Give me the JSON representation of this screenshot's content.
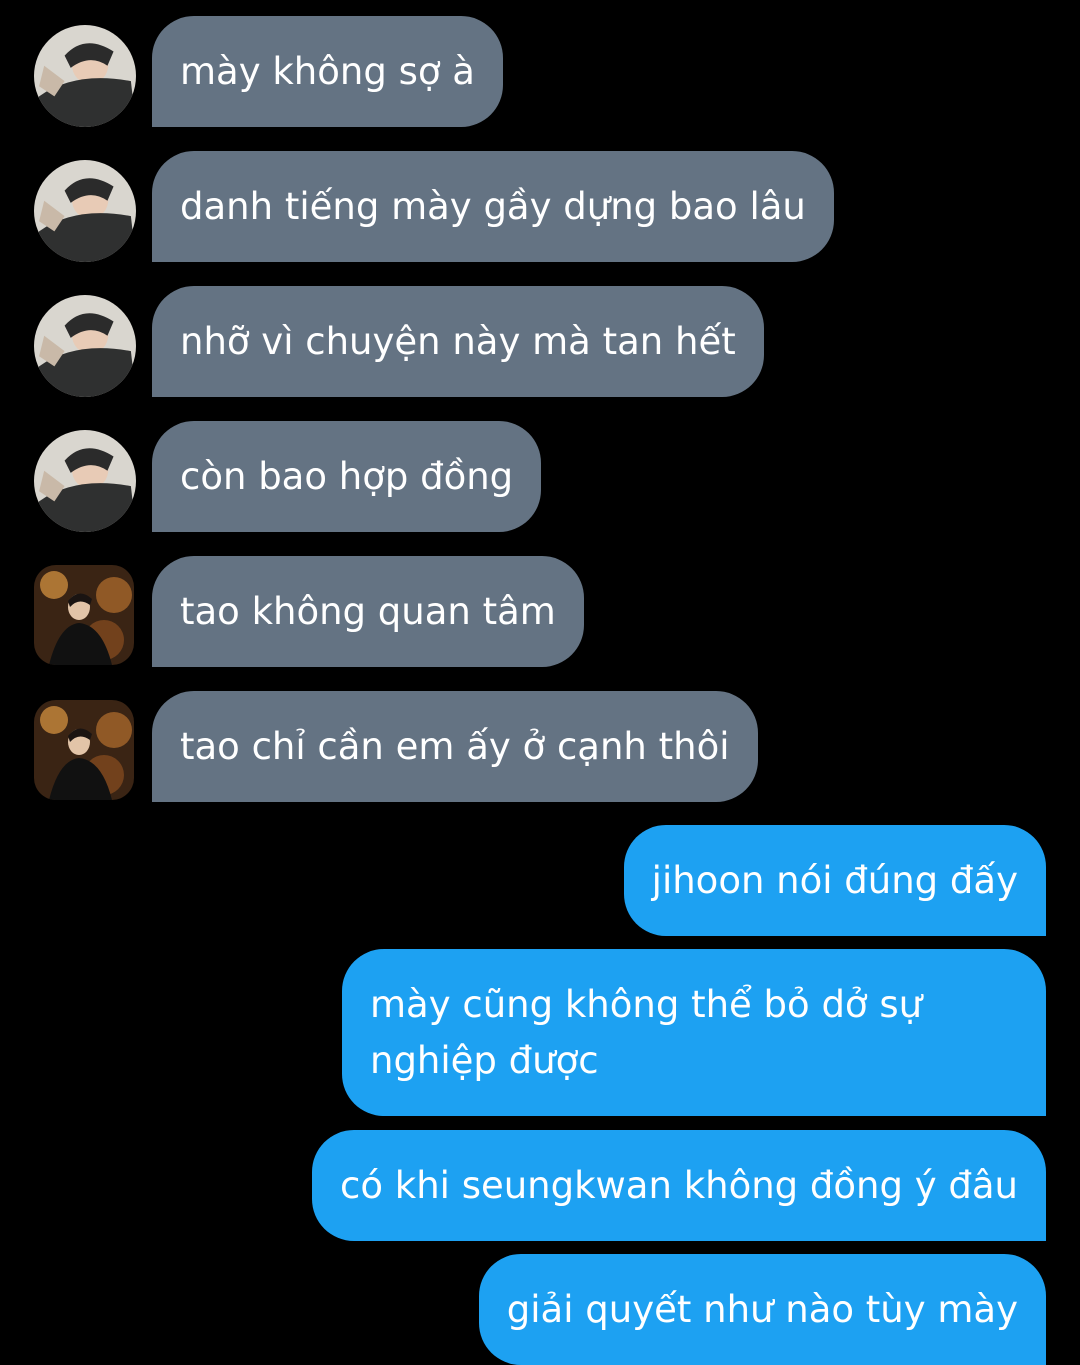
{
  "conversation": {
    "messages": [
      {
        "side": "in",
        "avatar": "avatar-a",
        "text": "mày không sợ à"
      },
      {
        "side": "in",
        "avatar": "avatar-a",
        "text": "danh tiếng mày gầy dựng bao lâu"
      },
      {
        "side": "in",
        "avatar": "avatar-a",
        "text": "nhỡ vì chuyện này mà tan hết"
      },
      {
        "side": "in",
        "avatar": "avatar-a",
        "text": "còn bao hợp đồng"
      },
      {
        "side": "in",
        "avatar": "avatar-b",
        "text": "tao không quan tâm"
      },
      {
        "side": "in",
        "avatar": "avatar-b",
        "text": "tao chỉ cần em ấy ở cạnh thôi"
      },
      {
        "side": "out",
        "text": "jihoon nói đúng đấy"
      },
      {
        "side": "out",
        "text": "mày cũng không thể bỏ dở sự nghiệp được"
      },
      {
        "side": "out",
        "text": "có khi seungkwan không đồng ý đâu"
      },
      {
        "side": "out",
        "text": "giải quyết như nào tùy mày"
      }
    ]
  },
  "colors": {
    "background": "#000000",
    "incoming_bubble": "#647383",
    "outgoing_bubble": "#1da1f2",
    "text": "#ffffff"
  },
  "icons": {
    "avatar_a": "profile-photo-icon",
    "avatar_b": "profile-photo-icon"
  }
}
